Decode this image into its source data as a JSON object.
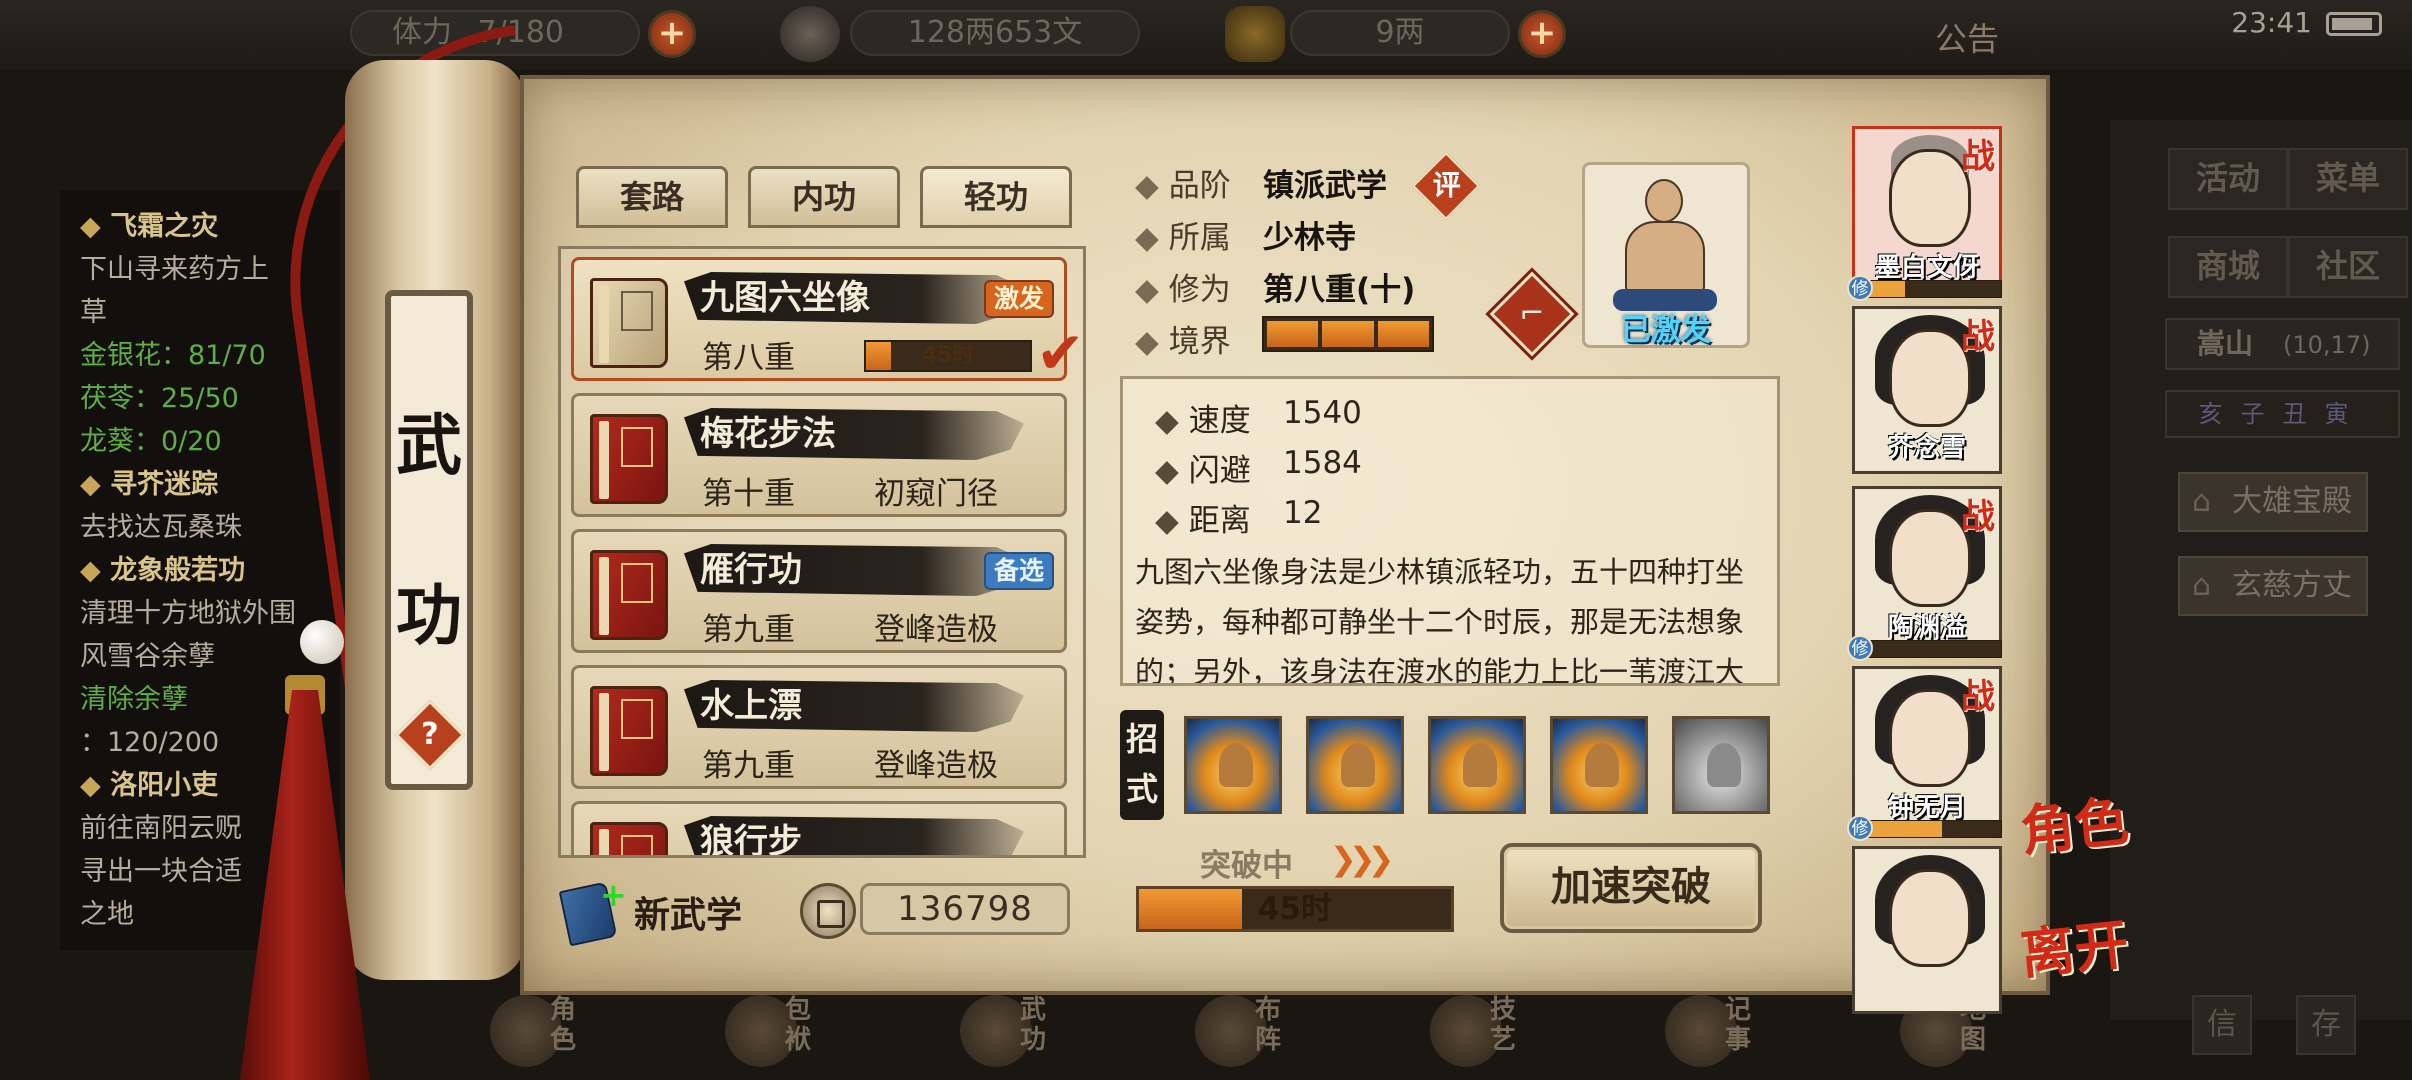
{
  "status_bar": {
    "stamina_label": "体力",
    "stamina_value": "7/180",
    "money": "128两653文",
    "ingots": "9两",
    "notice": "公告",
    "time": "23:41"
  },
  "quests": [
    {
      "type": "h",
      "text": "飞霜之灾"
    },
    {
      "type": "d",
      "text": "下山寻来药方上"
    },
    {
      "type": "d",
      "text": "草"
    },
    {
      "type": "g",
      "text": "金银花：81/70"
    },
    {
      "type": "g",
      "text": "茯苓：25/50"
    },
    {
      "type": "g",
      "text": "龙葵：0/20"
    },
    {
      "type": "h",
      "text": "寻芥迷踪"
    },
    {
      "type": "d",
      "text": "去找达瓦桑珠"
    },
    {
      "type": "h",
      "text": "龙象般若功"
    },
    {
      "type": "d",
      "text": "清理十方地狱外围"
    },
    {
      "type": "d",
      "text": "风雪谷余孽"
    },
    {
      "type": "g",
      "text": "清除余孽"
    },
    {
      "type": "d",
      "text": "：120/200"
    },
    {
      "type": "h",
      "text": "洛阳小吏"
    },
    {
      "type": "d",
      "text": "前往南阳云贶"
    },
    {
      "type": "d",
      "text": "寻出一块合适"
    },
    {
      "type": "d",
      "text": "之地"
    }
  ],
  "right_menu": {
    "buttons": [
      "活动",
      "菜单",
      "商城",
      "社区"
    ],
    "location_name": "嵩山",
    "location_coords": "(10,17)",
    "time_band": "亥子丑寅",
    "places": [
      "大雄宝殿",
      "玄慈方丈"
    ],
    "bottom_buttons": [
      "信",
      "存"
    ]
  },
  "bottom_nav": [
    {
      "label": "角色",
      "icon": "character-icon"
    },
    {
      "label": "包袱",
      "icon": "bag-icon"
    },
    {
      "label": "武功",
      "icon": "martial-arts-icon"
    },
    {
      "label": "布阵",
      "icon": "formation-icon"
    },
    {
      "label": "技艺",
      "icon": "craft-icon"
    },
    {
      "label": "记事",
      "icon": "journal-icon"
    },
    {
      "label": "地图",
      "icon": "map-icon"
    }
  ],
  "scroll": {
    "title_1": "武",
    "title_2": "功",
    "help": "?"
  },
  "tabs": [
    "套路",
    "内功",
    "轻功"
  ],
  "skills": [
    {
      "name": "九图六坐像",
      "level": "第八重",
      "stage": "",
      "tag": "激发",
      "tag_color": "orange",
      "progress_label": "45时",
      "progress": 0.15,
      "selected": true,
      "equipped": true,
      "icon": "scroll-book-icon"
    },
    {
      "name": "梅花步法",
      "level": "第十重",
      "stage": "初窥门径",
      "tag": "",
      "tag_color": "",
      "selected": false,
      "icon": "book-icon"
    },
    {
      "name": "雁行功",
      "level": "第九重",
      "stage": "登峰造极",
      "tag": "备选",
      "tag_color": "blue",
      "selected": false,
      "icon": "book-icon"
    },
    {
      "name": "水上漂",
      "level": "第九重",
      "stage": "登峰造极",
      "tag": "",
      "tag_color": "",
      "selected": false,
      "icon": "book-icon"
    },
    {
      "name": "狼行步",
      "level": "",
      "stage": "",
      "tag": "",
      "tag_color": "",
      "selected": false,
      "icon": "book-icon"
    }
  ],
  "new_skill": {
    "plus": "+",
    "label": "新武学"
  },
  "pages_count": "136798",
  "detail": {
    "grade_label": "品阶",
    "grade_value": "镇派武学",
    "comment": "评",
    "sect_label": "所属",
    "sect_value": "少林寺",
    "cultivation_label": "修为",
    "cultivation_value": "第八重(十)",
    "realm_label": "境界",
    "realm_fill": 3,
    "activated": "已激发",
    "boot_icon": "boot-icon",
    "stats": [
      {
        "label": "速度",
        "value": "1540"
      },
      {
        "label": "闪避",
        "value": "1584"
      },
      {
        "label": "距离",
        "value": "12"
      }
    ],
    "description": "九图六坐像身法是少林镇派轻功，五十四种打坐姿势，每种都可静坐十二个时辰，那是无法想象的；另外，该身法在渡水的能力上比一苇渡江大更胜一筹，依至崇峰，甚至",
    "moves_label": "招式",
    "moves": [
      "move-1",
      "move-2",
      "move-3",
      "move-4",
      "move-5"
    ],
    "breaking_label": "突破中",
    "breaking_arrows": "❯❯❯",
    "breaking_time": "45时",
    "breaking_progress": 0.33,
    "speedup_button": "加速突破"
  },
  "characters": [
    {
      "name": "墨白文伢",
      "battle": "战",
      "hair": "bald",
      "selected": true,
      "xiu": 0.35
    },
    {
      "name": "芥念雪",
      "battle": "战",
      "hair": "long",
      "selected": false
    },
    {
      "name": "陶渊溢",
      "battle": "战",
      "hair": "long",
      "selected": false,
      "xiu": 0.0
    },
    {
      "name": "钟无月",
      "battle": "战",
      "hair": "long",
      "selected": false,
      "xiu": 0.6
    },
    {
      "name": "",
      "battle": "",
      "hair": "long",
      "selected": false
    }
  ],
  "xiu_label": "修",
  "side_actions": {
    "role": "角色",
    "leave": "离开"
  }
}
